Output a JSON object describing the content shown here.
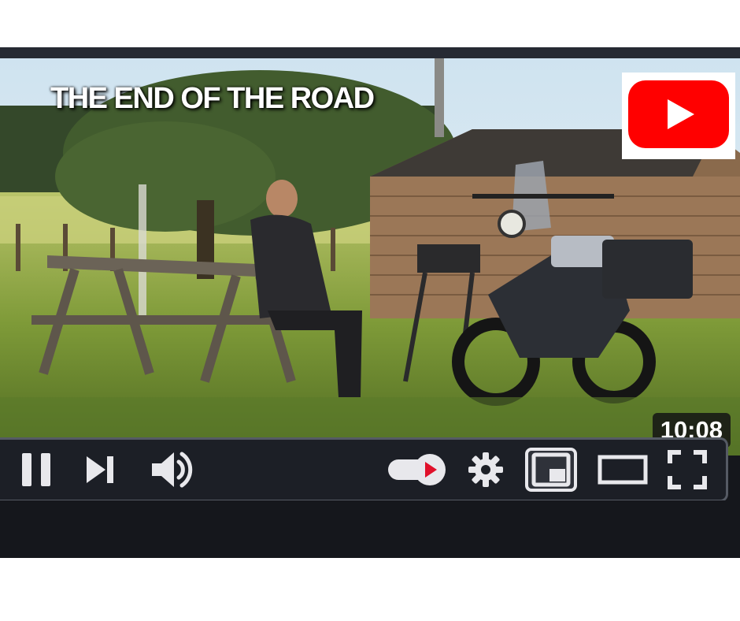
{
  "video": {
    "title_overlay": "THE END OF THE ROAD",
    "duration": "10:08"
  },
  "controls": {
    "play_state": "playing",
    "autoplay": "on"
  },
  "icons": {
    "brand": "youtube-logo-icon",
    "pause": "pause-icon",
    "next": "skip-next-icon",
    "volume": "volume-icon",
    "autoplay": "autoplay-toggle-icon",
    "settings": "gear-icon",
    "miniplayer": "miniplayer-icon",
    "theater": "theater-mode-icon",
    "fullscreen": "fullscreen-icon"
  },
  "colors": {
    "brand_red": "#ff0000",
    "controls_bg": "#1c1f26",
    "icon_color": "#e8e8ec"
  }
}
